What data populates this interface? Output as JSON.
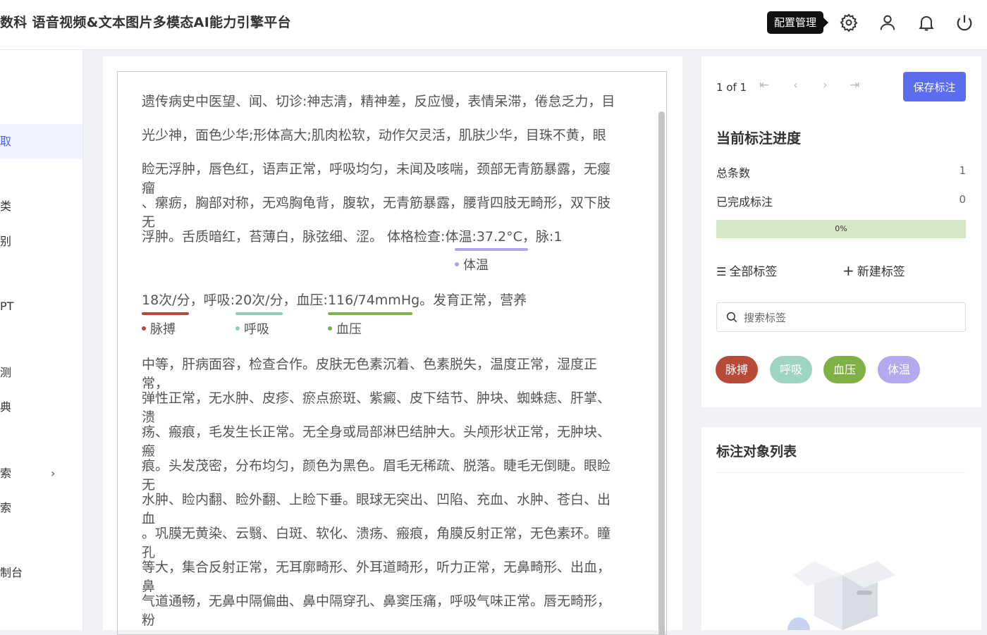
{
  "header": {
    "title": "数科  语音视频&文本图片多模态AI能力引擎平台",
    "tooltip": "配置管理",
    "icons": [
      "gear-icon",
      "user-icon",
      "bell-icon",
      "power-icon"
    ]
  },
  "sidebar": {
    "items": [
      {
        "label": "取",
        "active": true
      },
      {
        "label": "类"
      },
      {
        "label": "别"
      },
      {
        "label": "PT"
      },
      {
        "label": "测"
      },
      {
        "label": "典"
      },
      {
        "label": "索",
        "arrow": "›"
      },
      {
        "label": "索"
      },
      {
        "label": "制台"
      }
    ]
  },
  "document": {
    "lines": [
      "遗传病史中医望、闻、切诊:神志清，精神差，反应慢，表情呆滞，倦怠乏力，目",
      "光少神，面色少华;形体高大;肌肉松软，动作欠灵活，肌肤少华，目珠不黄，眼",
      "睑无浮肿，唇色红，语声正常，呼吸均匀，未闻及咳喘，颈部无青筋暴露，无瘿",
      "瘤",
      "、瘰疬，胸部对称，无鸡胸龟背，腹软，无青筋暴露，腰背四肢无畸形，双下肢",
      "无",
      "浮肿。舌质暗红，苔薄白，脉弦细、涩。 体格检查:体温:37.2°C，脉:1",
      "18次/分，呼吸:20次/分，血压:116/74mmHg。发育正常，营养",
      "中等，肝病面容，检查合作。皮肤无色素沉着、色素脱失，温度正常，湿度正",
      "常，",
      "弹性正常，无水肿、皮疹、瘀点瘀斑、紫癜、皮下结节、肿块、蜘蛛痣、肝掌、",
      "溃",
      "疡、瘢痕，毛发生长正常。无全身或局部淋巴结肿大。头颅形状正常，无肿块、",
      "瘢",
      "痕。头发茂密，分布均匀，颜色为黑色。眉毛无稀疏、脱落。睫毛无倒睫。眼睑",
      "无",
      "水肿、睑内翻、睑外翻、上睑下垂。眼球无突出、凹陷、充血、水肿、苍白、出",
      "血",
      "。巩膜无黄染、云翳、白斑、软化、溃疡、瘢痕，角膜反射正常，无色素环。瞳",
      "孔",
      "等大，集合反射正常，无耳廓畸形、外耳道畸形，听力正常，无鼻畸形、出血，",
      "鼻",
      "气道通畅，无鼻中隔偏曲、鼻中隔穿孔、鼻窦压痛，呼吸气味正常。唇无畸形，",
      "粉"
    ],
    "annotations": [
      {
        "label": "体温",
        "color": "#b3a3ee"
      },
      {
        "label": "脉搏",
        "color": "#b24a3c"
      },
      {
        "label": "呼吸",
        "color": "#91cdb9"
      },
      {
        "label": "血压",
        "color": "#7db34a"
      }
    ]
  },
  "right_panel": {
    "pager": "1 of 1",
    "pager_buttons": [
      "first-page-icon",
      "prev-page-icon",
      "next-page-icon",
      "last-page-icon"
    ],
    "save_label": "保存标注",
    "progress_title": "当前标注进度",
    "total_label": "总条数",
    "total_value": "1",
    "done_label": "已完成标注",
    "done_value": "0",
    "progress_value": 0,
    "progress_text": "0%",
    "all_tags_label": "全部标签",
    "new_tag_label": "新建标签",
    "search_placeholder": "搜索标签",
    "tags": [
      {
        "label": "脉搏",
        "color": "#b84a38"
      },
      {
        "label": "呼吸",
        "color": "#9fd3c3"
      },
      {
        "label": "血压",
        "color": "#7fb046"
      },
      {
        "label": "体温",
        "color": "#b6a8ef"
      }
    ],
    "object_list_title": "标注对象列表"
  }
}
